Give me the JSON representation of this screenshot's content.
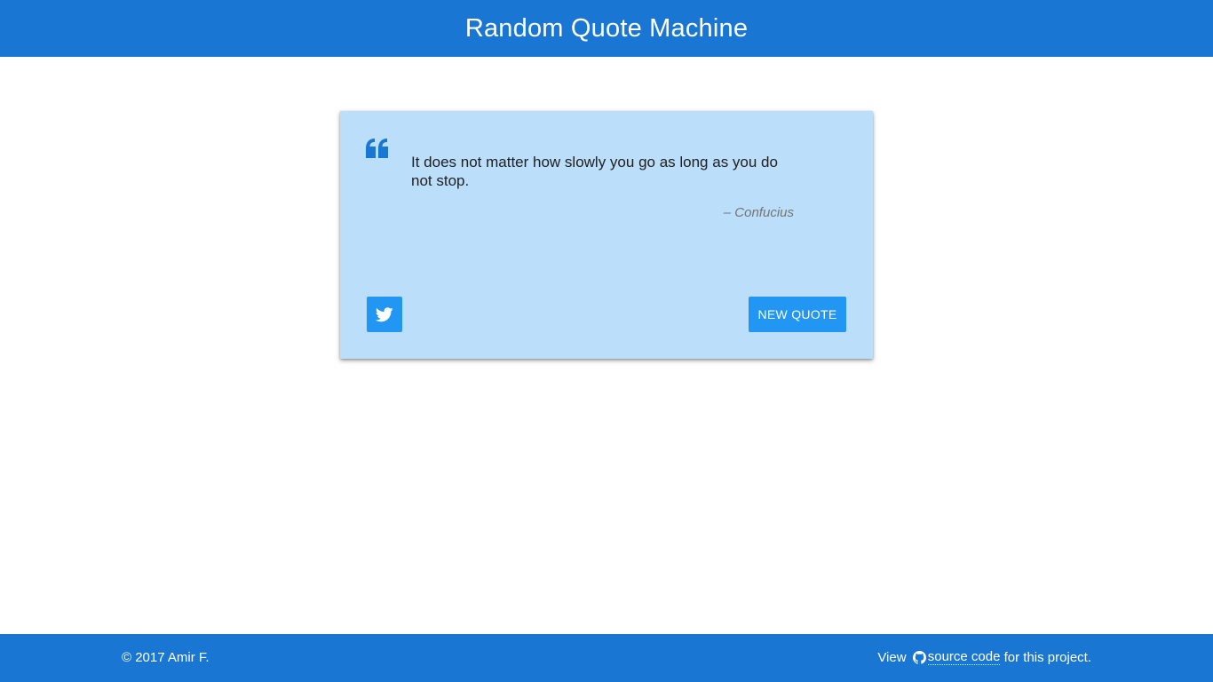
{
  "header": {
    "title": "Random Quote Machine"
  },
  "quote": {
    "icon": "quote-left-icon",
    "text": "It does not matter how slowly you go as long as you do not stop.",
    "author": "– Confucius"
  },
  "actions": {
    "tweet_icon": "twitter-icon",
    "new_quote_label": "NEW QUOTE"
  },
  "footer": {
    "copyright": "© 2017 Amir F.",
    "view_prefix": "View ",
    "github_icon": "github-icon",
    "source_link": "source code",
    "view_suffix": " for this project."
  },
  "colors": {
    "primary": "#1976d2",
    "card_background": "#bbdefb",
    "button": "#2196f3",
    "quote_icon": "#1976d2",
    "author_text": "#757575"
  }
}
